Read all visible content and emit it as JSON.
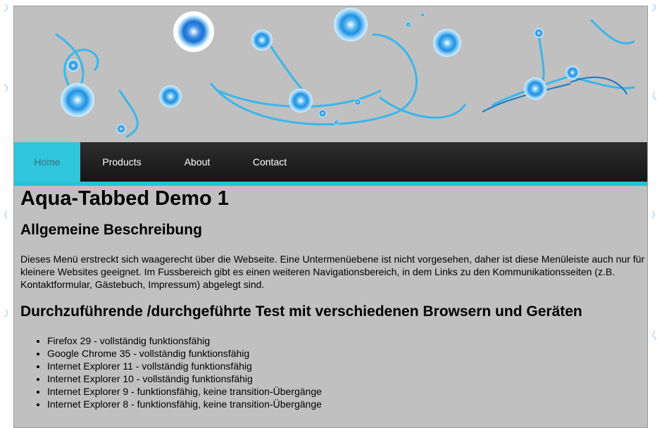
{
  "nav": {
    "items": [
      {
        "label": "Home",
        "active": true
      },
      {
        "label": "Products",
        "active": false
      },
      {
        "label": "About",
        "active": false
      },
      {
        "label": "Contact",
        "active": false
      }
    ]
  },
  "main": {
    "title": "Aqua-Tabbed Demo 1",
    "section1_heading": "Allgemeine Beschreibung",
    "section1_text": "Dieses Menü erstreckt sich waagerecht über die Webseite. Eine Untermenüebene ist nicht vorgesehen, daher ist diese Menüleiste auch nur für kleinere Websites geeignet. Im Fussbereich gibt es einen weiteren Navigationsbereich, in dem Links zu den Kommunikationsseiten (z.B. Kontaktformular, Gästebuch, Impressum) abgelegt sind.",
    "section2_heading": "Durchzuführende /durchgeführte Test mit verschiedenen Browsern und Geräten",
    "tests": [
      "Firefox 29 - vollständig funktionsfähig",
      "Google Chrome 35 - vollständig funktionsfähig",
      "Internet Explorer 11 - vollständig funktionsfähig",
      "Internet Explorer 10 - vollständig funktionsfähig",
      "Internet Explorer 9 - funktionsfähig, keine transition-Übergänge",
      "Internet Explorer 8 - funktionsfähig, keine transition-Übergänge"
    ]
  },
  "colors": {
    "page_bg": "#c0c0c0",
    "nav_bg": "#1e1e1e",
    "accent": "#2fc6dc",
    "active_text": "#3a6f7e",
    "bubble": "#2aa4e8"
  },
  "banner": {
    "decoration": "blue-swirl-bubbles"
  }
}
